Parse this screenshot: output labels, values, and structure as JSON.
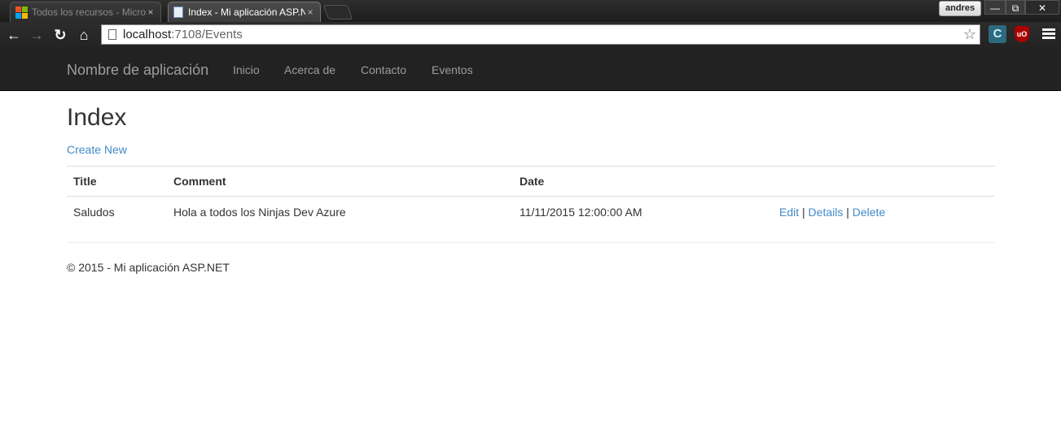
{
  "browser": {
    "tabs": [
      {
        "title": "Todos los recursos - Microsoft Azure",
        "favicon": "microsoft-logo-icon",
        "active": false
      },
      {
        "title": "Index - Mi aplicación ASP.NET",
        "favicon": "page-icon",
        "active": true
      }
    ],
    "close_glyph": "×",
    "user": "andres",
    "window_controls": {
      "minimize": "—",
      "maximize": "⧉",
      "close": "✕"
    },
    "nav": {
      "back": "←",
      "forward": "→",
      "reload": "↻",
      "home": "⌂"
    },
    "url_host": "localhost",
    "url_rest": ":7108/Events",
    "bookmark_glyph": "☆",
    "extensions": [
      {
        "icon": "copy-extension-icon",
        "glyph": "C"
      },
      {
        "icon": "ublock-icon",
        "glyph": "uO"
      }
    ]
  },
  "navbar": {
    "brand": "Nombre de aplicación",
    "links": [
      "Inicio",
      "Acerca de",
      "Contacto",
      "Eventos"
    ]
  },
  "page": {
    "title": "Index",
    "create_link": "Create New"
  },
  "table": {
    "headers": [
      "Title",
      "Comment",
      "Date",
      ""
    ],
    "rows": [
      {
        "title": "Saludos",
        "comment": "Hola a todos los Ninjas Dev Azure",
        "date": "11/11/2015 12:00:00 AM",
        "actions": {
          "edit": "Edit",
          "details": "Details",
          "delete": "Delete",
          "separator": "|"
        }
      }
    ]
  },
  "footer": {
    "text": "© 2015 - Mi aplicación ASP.NET"
  },
  "colors": {
    "navbar_bg": "#222222",
    "link": "#428bca",
    "nav_text": "#9d9d9d"
  }
}
